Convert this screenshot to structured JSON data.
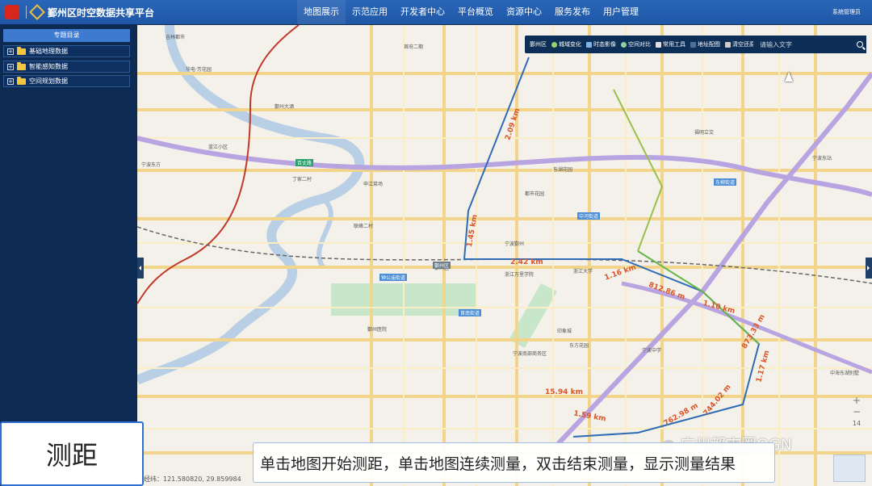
{
  "header": {
    "title": "鄞州区时空数据共享平台",
    "nav": [
      "地图展示",
      "示范应用",
      "开发者中心",
      "平台概览",
      "资源中心",
      "服务发布",
      "用户管理"
    ],
    "user": "系统管理员"
  },
  "sidebar": {
    "heading": "专题目录",
    "items": [
      {
        "label": "基础地理数据"
      },
      {
        "label": "智能感知数据"
      },
      {
        "label": "空间规划数据"
      }
    ]
  },
  "toolbar": {
    "items": [
      {
        "label": "鄞州区"
      },
      {
        "label": "城域变化"
      },
      {
        "label": "时态影像"
      },
      {
        "label": "空间对比"
      },
      {
        "label": "常用工具"
      },
      {
        "label": "地址配图"
      },
      {
        "label": "清空还原"
      }
    ],
    "search_placeholder": "请输入文字"
  },
  "map": {
    "zoom_level": "14",
    "coordinates": "经纬：121.580820, 29.859984",
    "distances": [
      "2.09 km",
      "1.45 km",
      "2.42 km",
      "1.16 km",
      "812.86 m",
      "1.10 km",
      "873.33 m",
      "1.17 km",
      "15.94 km",
      "1.59 km",
      "762.98 m",
      "744.02 m"
    ],
    "places": [
      "吉林都市",
      "首府二期",
      "华电·芳花园",
      "鄞州大酒",
      "宁波东方",
      "蓝江小区",
      "丁家二村",
      "申江菜场",
      "东湖花园",
      "都市花园",
      "联峰二村",
      "宁波鄞州",
      "浙江大学",
      "浙江万里学院",
      "鄞州医院",
      "宁波南部商务区",
      "印象城",
      "宁波中学",
      "东方花园",
      "鄞州区",
      "福明立交",
      "宁波东站",
      "中海东湖别墅"
    ],
    "tags": [
      {
        "label": "鄞州区",
        "style": "gray"
      },
      {
        "label": "百丈路",
        "style": "green"
      },
      {
        "label": "中河街道",
        "style": "blue"
      },
      {
        "label": "钟公庙街道",
        "style": "blue"
      },
      {
        "label": "首南街道",
        "style": "blue"
      },
      {
        "label": "东柳街道",
        "style": "blue"
      }
    ]
  },
  "caption": "测距",
  "subtitle": "单击地图开始测距，单击地图连续测量，双击结束测量，显示测量结果",
  "watermark": "广州都市圈OGN"
}
